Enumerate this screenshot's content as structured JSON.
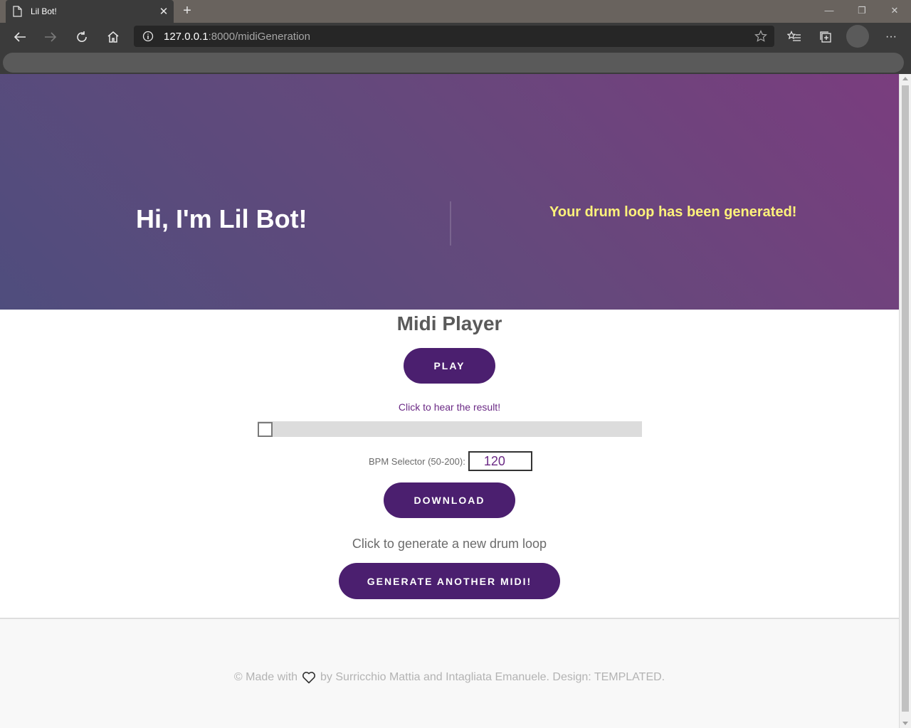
{
  "browser": {
    "tab_title": "Lil Bot!",
    "tab_close": "✕",
    "new_tab": "+",
    "url_host": "127.0.0.1",
    "url_rest": ":8000/midiGeneration",
    "window_controls": {
      "minimize": "—",
      "restore": "❐",
      "close": "✕"
    },
    "more_menu": "···"
  },
  "hero": {
    "title": "Hi, I'm Lil Bot!",
    "message": "Your drum loop has been generated!"
  },
  "player": {
    "title": "Midi Player",
    "play_label": "PLAY",
    "hint": "Click to hear the result!",
    "progress": 0,
    "bpm_label": "BPM Selector (50-200):",
    "bpm_value": "120",
    "download_label": "DOWNLOAD",
    "regen_text": "Click to generate a new drum loop",
    "generate_label": "GENERATE ANOTHER MIDI!"
  },
  "footer": {
    "prefix": "© Made with",
    "suffix": "by Surricchio Mattia and Intagliata Emanuele. Design: TEMPLATED."
  },
  "colors": {
    "button": "#4b1f6f",
    "hero_message": "#fff27a",
    "hero_gradient": [
      "#4f4d7d",
      "#7a3d7e"
    ],
    "accent_text": "#6b2a85"
  }
}
